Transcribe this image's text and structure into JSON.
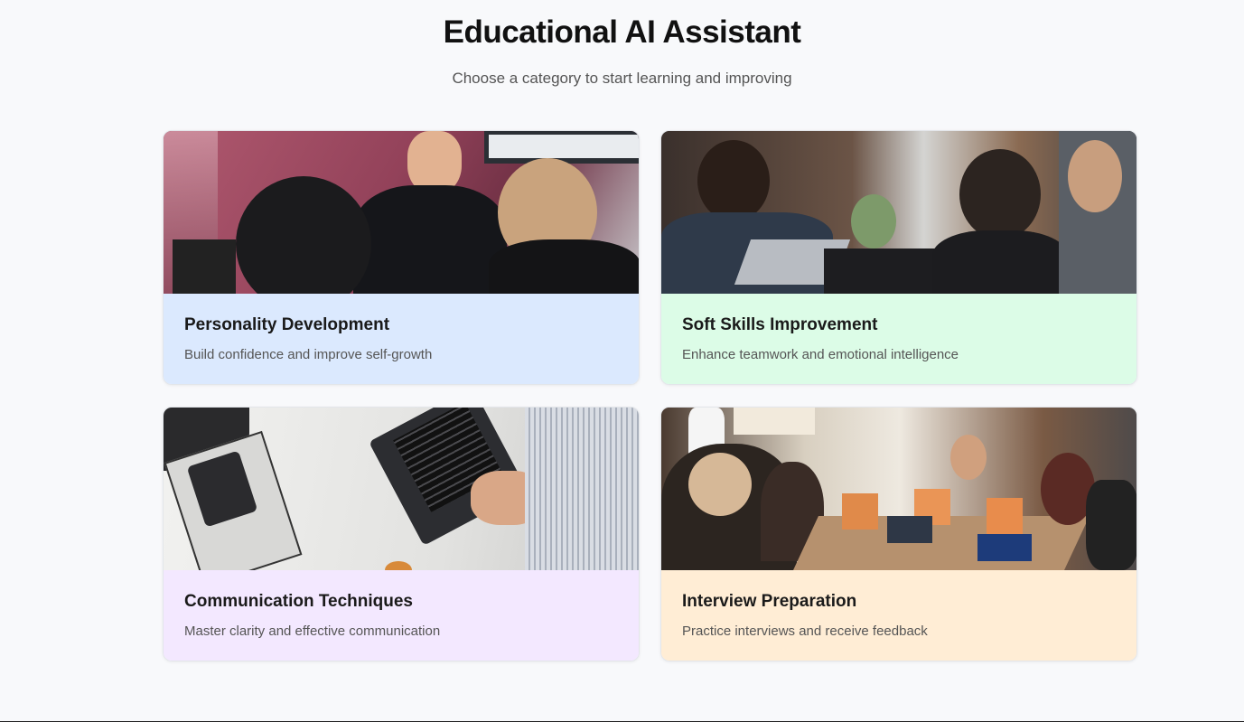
{
  "header": {
    "title": "Educational AI Assistant",
    "subtitle": "Choose a category to start learning and improving"
  },
  "categories": [
    {
      "title": "Personality Development",
      "description": "Build confidence and improve self-growth",
      "body_color": "#dbe9fe",
      "image": "meeting-discussion-photo"
    },
    {
      "title": "Soft Skills Improvement",
      "description": "Enhance teamwork and emotional intelligence",
      "body_color": "#dcfce7",
      "image": "team-working-laptops-photo"
    },
    {
      "title": "Communication Techniques",
      "description": "Master clarity and effective communication",
      "body_color": "#f3e8ff",
      "image": "desk-laptop-phone-photo"
    },
    {
      "title": "Interview Preparation",
      "description": "Practice interviews and receive feedback",
      "body_color": "#ffedd5",
      "image": "conference-room-meeting-photo"
    }
  ]
}
